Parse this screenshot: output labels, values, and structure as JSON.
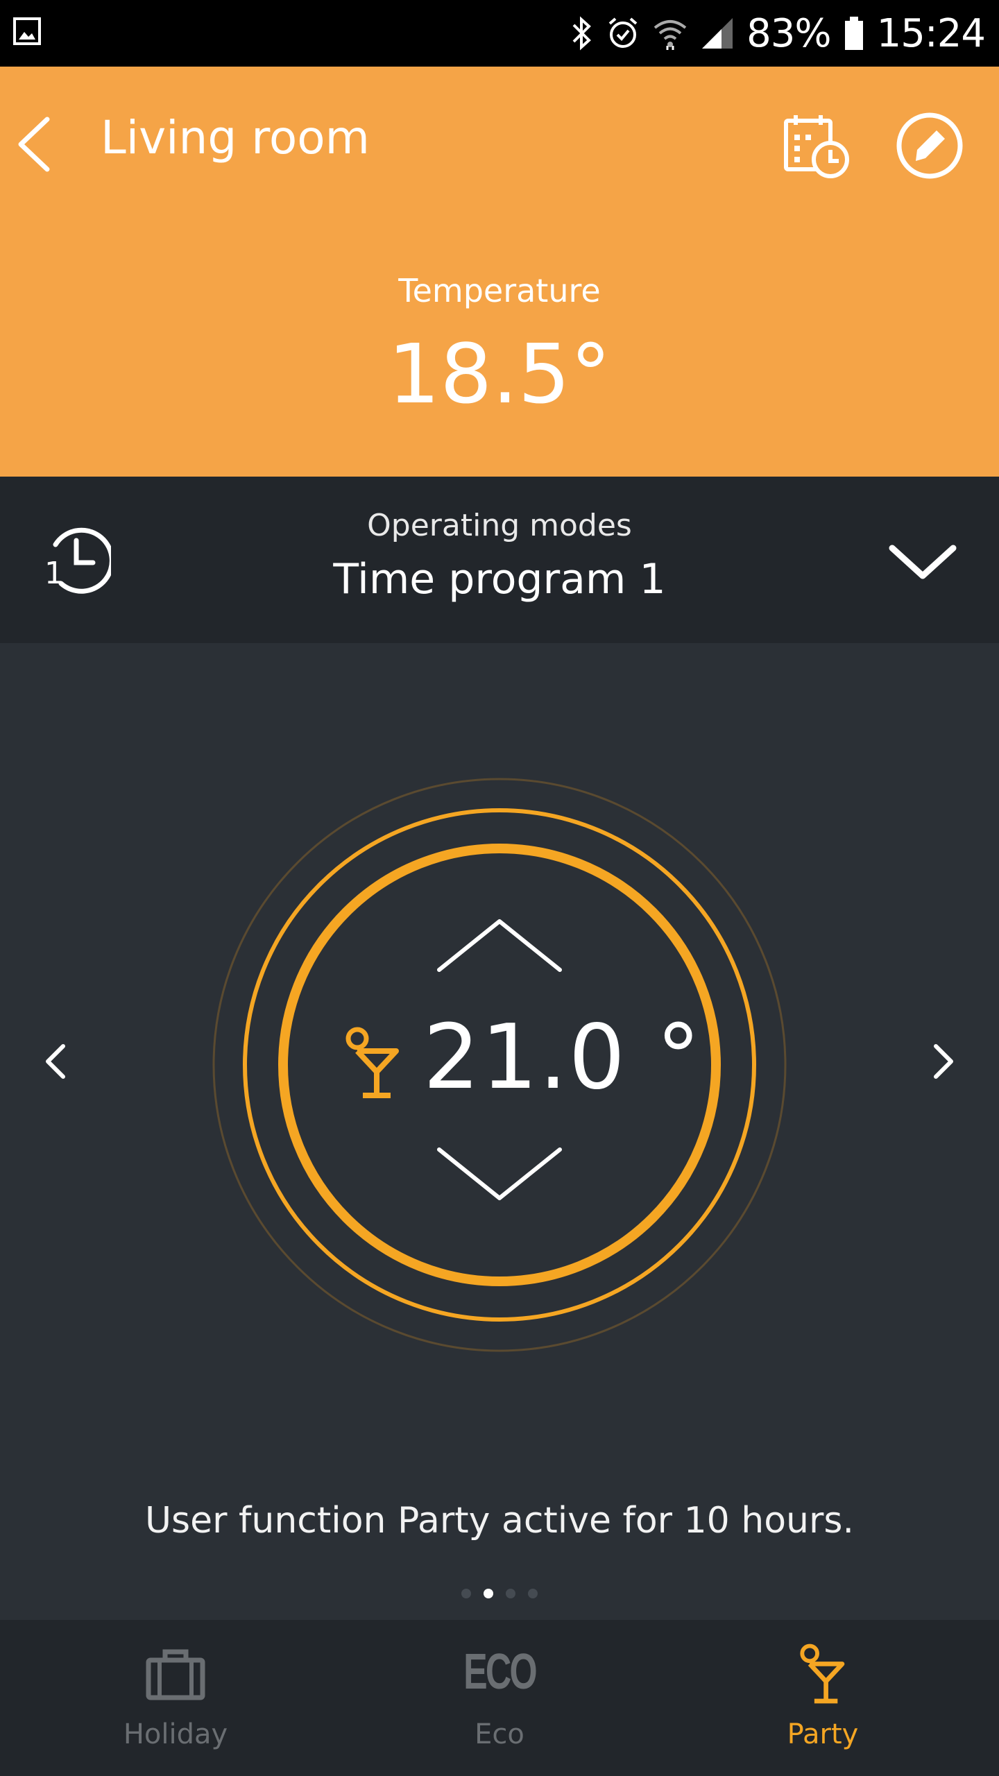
{
  "status_bar": {
    "battery_percent": "83%",
    "time": "15:24",
    "icons": [
      "gallery-icon",
      "bluetooth-icon",
      "alarm-icon",
      "wifi-icon",
      "signal-icon",
      "battery-icon"
    ]
  },
  "header": {
    "title": "Living room",
    "temperature_label": "Temperature",
    "temperature_value": "18.5°",
    "background_color": "#f5a447",
    "icons": [
      "back-arrow-icon",
      "calendar-clock-icon",
      "edit-pencil-icon"
    ]
  },
  "operating_modes": {
    "label": "Operating modes",
    "value": "Time program 1",
    "icons": [
      "time-program-icon",
      "chevron-down-icon"
    ]
  },
  "dial": {
    "setpoint": "21.0 °",
    "accent_color": "#f5a623",
    "icons": [
      "chevron-up-icon",
      "chevron-down-icon",
      "cocktail-icon",
      "chevron-left-icon",
      "chevron-right-icon"
    ]
  },
  "info_text": "User function Party active for 10 hours.",
  "pagination": {
    "count": 4,
    "active_index": 1
  },
  "bottom_nav": {
    "items": [
      {
        "label": "Holiday",
        "icon": "suitcase-icon",
        "active": false
      },
      {
        "label": "Eco",
        "icon_text": "ECO",
        "icon": "eco-icon",
        "active": false
      },
      {
        "label": "Party",
        "icon": "cocktail-icon",
        "active": true
      }
    ],
    "active_color": "#f5a623",
    "inactive_color": "#6a6e72"
  }
}
